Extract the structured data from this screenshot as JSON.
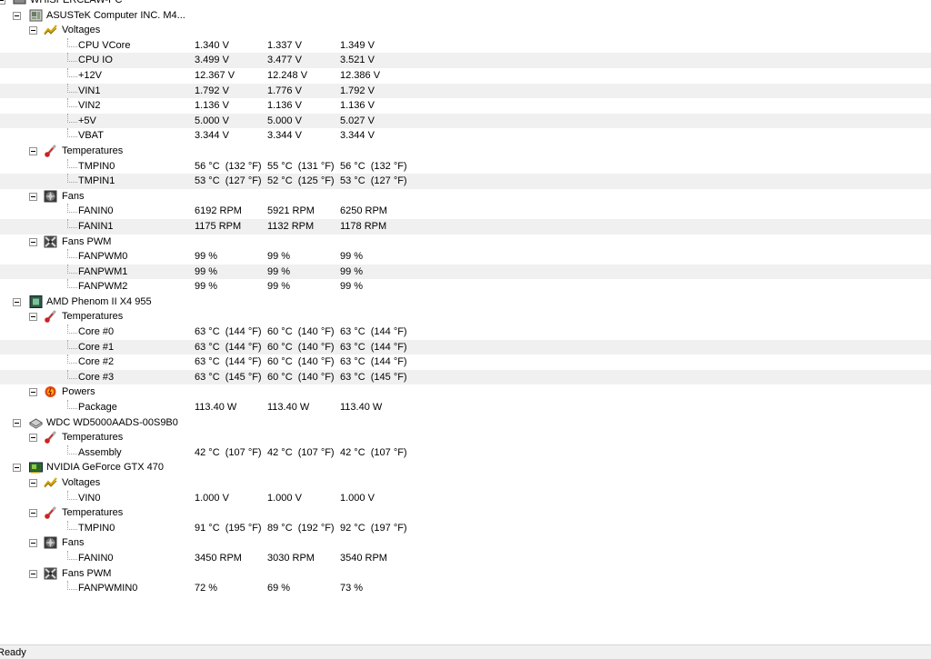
{
  "tree": [
    {
      "kind": "computer",
      "label": "WHISPERCLAW-PC",
      "level": 0,
      "icon": "computer-icon"
    },
    {
      "kind": "hardware",
      "label": "ASUSTeK Computer INC. M4...",
      "level": 1,
      "icon": "motherboard-icon"
    },
    {
      "kind": "group",
      "label": "Voltages",
      "level": 2,
      "icon": "voltage-icon"
    },
    {
      "kind": "sensor",
      "label": "CPU VCore",
      "values": [
        "1.340 V",
        "1.337 V",
        "1.349 V"
      ],
      "level": 3
    },
    {
      "kind": "sensor",
      "label": "CPU IO",
      "values": [
        "3.499 V",
        "3.477 V",
        "3.521 V"
      ],
      "level": 3
    },
    {
      "kind": "sensor",
      "label": "+12V",
      "values": [
        "12.367 V",
        "12.248 V",
        "12.386 V"
      ],
      "level": 3
    },
    {
      "kind": "sensor",
      "label": "VIN1",
      "values": [
        "1.792 V",
        "1.776 V",
        "1.792 V"
      ],
      "level": 3
    },
    {
      "kind": "sensor",
      "label": "VIN2",
      "values": [
        "1.136 V",
        "1.136 V",
        "1.136 V"
      ],
      "level": 3
    },
    {
      "kind": "sensor",
      "label": "+5V",
      "values": [
        "5.000 V",
        "5.000 V",
        "5.027 V"
      ],
      "level": 3
    },
    {
      "kind": "sensor",
      "label": "VBAT",
      "values": [
        "3.344 V",
        "3.344 V",
        "3.344 V"
      ],
      "level": 3
    },
    {
      "kind": "group",
      "label": "Temperatures",
      "level": 2,
      "icon": "thermometer-icon"
    },
    {
      "kind": "sensor",
      "label": "TMPIN0",
      "values": [
        "56 °C  (132 °F)",
        "55 °C  (131 °F)",
        "56 °C  (132 °F)"
      ],
      "level": 3
    },
    {
      "kind": "sensor",
      "label": "TMPIN1",
      "values": [
        "53 °C  (127 °F)",
        "52 °C  (125 °F)",
        "53 °C  (127 °F)"
      ],
      "level": 3
    },
    {
      "kind": "group",
      "label": "Fans",
      "level": 2,
      "icon": "fan-icon"
    },
    {
      "kind": "sensor",
      "label": "FANIN0",
      "values": [
        "6192 RPM",
        "5921 RPM",
        "6250 RPM"
      ],
      "level": 3
    },
    {
      "kind": "sensor",
      "label": "FANIN1",
      "values": [
        "1175 RPM",
        "1132 RPM",
        "1178 RPM"
      ],
      "level": 3
    },
    {
      "kind": "group",
      "label": "Fans PWM",
      "level": 2,
      "icon": "fan-pwm-icon"
    },
    {
      "kind": "sensor",
      "label": "FANPWM0",
      "values": [
        "99 %",
        "99 %",
        "99 %"
      ],
      "level": 3
    },
    {
      "kind": "sensor",
      "label": "FANPWM1",
      "values": [
        "99 %",
        "99 %",
        "99 %"
      ],
      "level": 3
    },
    {
      "kind": "sensor",
      "label": "FANPWM2",
      "values": [
        "99 %",
        "99 %",
        "99 %"
      ],
      "level": 3
    },
    {
      "kind": "hardware",
      "label": "AMD Phenom II X4 955",
      "level": 1,
      "icon": "cpu-icon"
    },
    {
      "kind": "group",
      "label": "Temperatures",
      "level": 2,
      "icon": "thermometer-icon"
    },
    {
      "kind": "sensor",
      "label": "Core #0",
      "values": [
        "63 °C  (144 °F)",
        "60 °C  (140 °F)",
        "63 °C  (144 °F)"
      ],
      "level": 3
    },
    {
      "kind": "sensor",
      "label": "Core #1",
      "values": [
        "63 °C  (144 °F)",
        "60 °C  (140 °F)",
        "63 °C  (144 °F)"
      ],
      "level": 3
    },
    {
      "kind": "sensor",
      "label": "Core #2",
      "values": [
        "63 °C  (144 °F)",
        "60 °C  (140 °F)",
        "63 °C  (144 °F)"
      ],
      "level": 3
    },
    {
      "kind": "sensor",
      "label": "Core #3",
      "values": [
        "63 °C  (145 °F)",
        "60 °C  (140 °F)",
        "63 °C  (145 °F)"
      ],
      "level": 3
    },
    {
      "kind": "group",
      "label": "Powers",
      "level": 2,
      "icon": "power-icon"
    },
    {
      "kind": "sensor",
      "label": "Package",
      "values": [
        "113.40 W",
        "113.40 W",
        "113.40 W"
      ],
      "level": 3
    },
    {
      "kind": "hardware",
      "label": "WDC WD5000AADS-00S9B0",
      "level": 1,
      "icon": "hdd-icon"
    },
    {
      "kind": "group",
      "label": "Temperatures",
      "level": 2,
      "icon": "thermometer-icon"
    },
    {
      "kind": "sensor",
      "label": "Assembly",
      "values": [
        "42 °C  (107 °F)",
        "42 °C  (107 °F)",
        "42 °C  (107 °F)"
      ],
      "level": 3
    },
    {
      "kind": "hardware",
      "label": "NVIDIA GeForce GTX 470",
      "level": 1,
      "icon": "gpu-icon"
    },
    {
      "kind": "group",
      "label": "Voltages",
      "level": 2,
      "icon": "voltage-icon"
    },
    {
      "kind": "sensor",
      "label": "VIN0",
      "values": [
        "1.000 V",
        "1.000 V",
        "1.000 V"
      ],
      "level": 3
    },
    {
      "kind": "group",
      "label": "Temperatures",
      "level": 2,
      "icon": "thermometer-icon"
    },
    {
      "kind": "sensor",
      "label": "TMPIN0",
      "values": [
        "91 °C  (195 °F)",
        "89 °C  (192 °F)",
        "92 °C  (197 °F)"
      ],
      "level": 3
    },
    {
      "kind": "group",
      "label": "Fans",
      "level": 2,
      "icon": "fan-icon"
    },
    {
      "kind": "sensor",
      "label": "FANIN0",
      "values": [
        "3450 RPM",
        "3030 RPM",
        "3540 RPM"
      ],
      "level": 3
    },
    {
      "kind": "group",
      "label": "Fans PWM",
      "level": 2,
      "icon": "fan-pwm-icon"
    },
    {
      "kind": "sensor",
      "label": "FANPWMIN0",
      "values": [
        "72 %",
        "69 %",
        "73 %"
      ],
      "level": 3
    }
  ],
  "status": {
    "text": "Ready"
  }
}
